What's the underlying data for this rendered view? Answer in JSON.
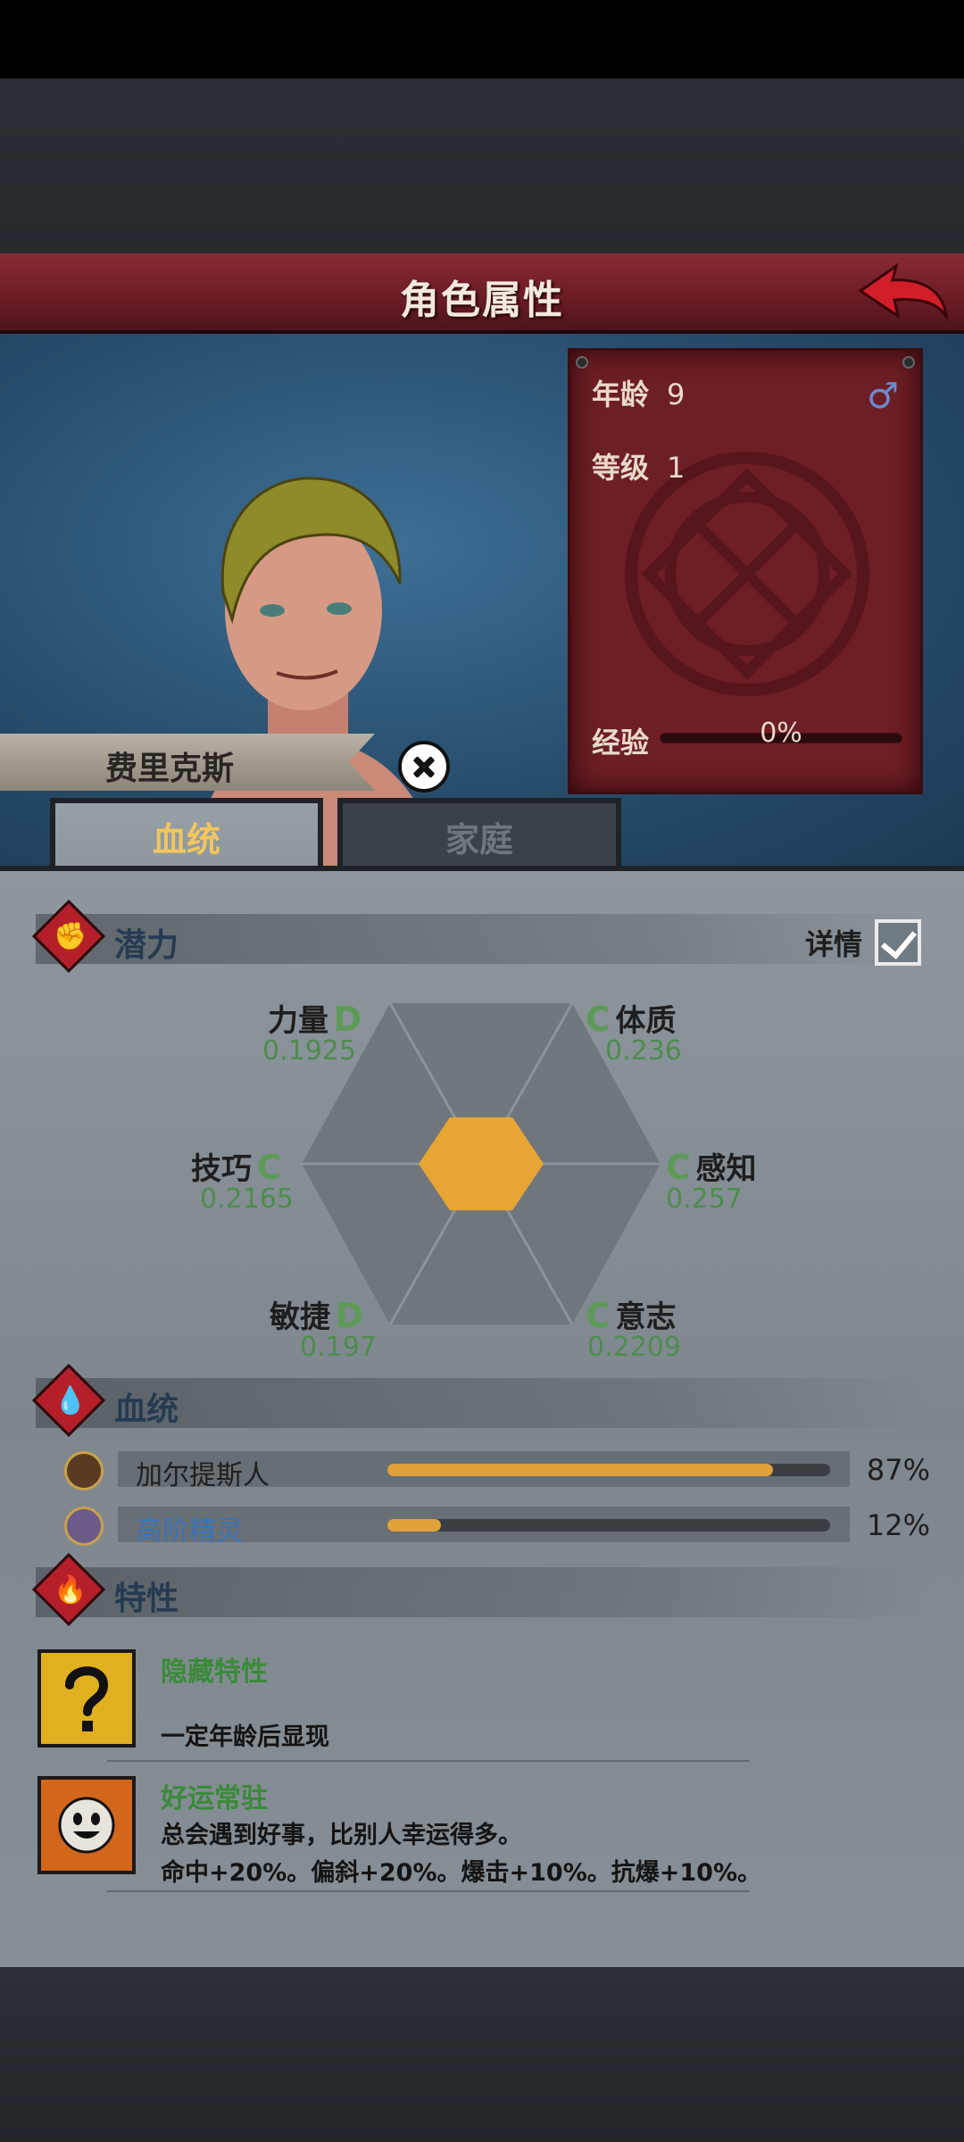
{
  "header": {
    "title": "角色属性"
  },
  "character": {
    "name": "费里克斯",
    "age_label": "年龄",
    "age": "9",
    "level_label": "等级",
    "level": "1",
    "gender_icon": "male-symbol",
    "xp_label": "经验",
    "xp_percent_text": "0%",
    "xp_progress": 0
  },
  "tabs": [
    {
      "label": "血统",
      "active": true
    },
    {
      "label": "家庭",
      "active": false
    }
  ],
  "potential": {
    "title": "潜力",
    "detail_label": "详情",
    "detail_checked": true,
    "stats": [
      {
        "name": "力量",
        "grade": "D",
        "value": "0.1925"
      },
      {
        "name": "体质",
        "grade": "C",
        "value": "0.236"
      },
      {
        "name": "技巧",
        "grade": "C",
        "value": "0.2165"
      },
      {
        "name": "感知",
        "grade": "C",
        "value": "0.257"
      },
      {
        "name": "敏捷",
        "grade": "D",
        "value": "0.197"
      },
      {
        "name": "意志",
        "grade": "C",
        "value": "0.2209"
      }
    ]
  },
  "bloodline": {
    "title": "血统",
    "entries": [
      {
        "name": "加尔提斯人",
        "percent_text": "87%",
        "fraction": 0.87,
        "color": "#1e1e1e"
      },
      {
        "name": "高阶精灵",
        "percent_text": "12%",
        "fraction": 0.12,
        "color": "#3a72b8"
      }
    ]
  },
  "traits": {
    "title": "特性",
    "items": [
      {
        "name": "隐藏特性",
        "desc": "一定年龄后显现",
        "icon": "question-mark-icon"
      },
      {
        "name": "好运常驻",
        "desc": "总会遇到好事，比别人幸运得多。",
        "effects": "命中+20%。偏斜+20%。爆击+10%。抗爆+10%。",
        "icon": "smiley-sun-icon"
      }
    ]
  },
  "colors": {
    "accent_red": "#b41f2a",
    "gold": "#e0a03a",
    "grade_green": "#5d9a58"
  }
}
